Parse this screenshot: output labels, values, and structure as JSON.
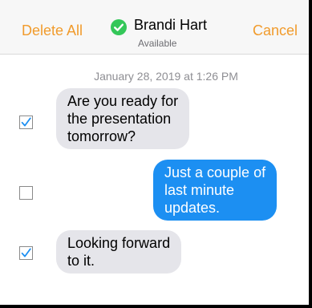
{
  "header": {
    "delete_all_label": "Delete All",
    "cancel_label": "Cancel",
    "contact_name": "Brandi Hart",
    "contact_status": "Available",
    "accent_color": "#f19b2c",
    "verified_icon": "check-circle-icon",
    "verified_color": "#34c759"
  },
  "conversation": {
    "timestamp": "January 28, 2019 at 1:26 PM",
    "messages": [
      {
        "direction": "incoming",
        "selected": true,
        "lines": [
          "Are you ready for",
          "the presentation",
          "tomorrow?"
        ]
      },
      {
        "direction": "outgoing",
        "selected": false,
        "lines": [
          "Just a couple of",
          "last minute",
          "updates."
        ]
      },
      {
        "direction": "incoming",
        "selected": true,
        "lines": [
          "Looking forward",
          "to it."
        ]
      }
    ]
  },
  "colors": {
    "incoming_bubble": "#e5e5ea",
    "outgoing_bubble": "#1c8ff2",
    "checkmark": "#1c8ff2"
  }
}
